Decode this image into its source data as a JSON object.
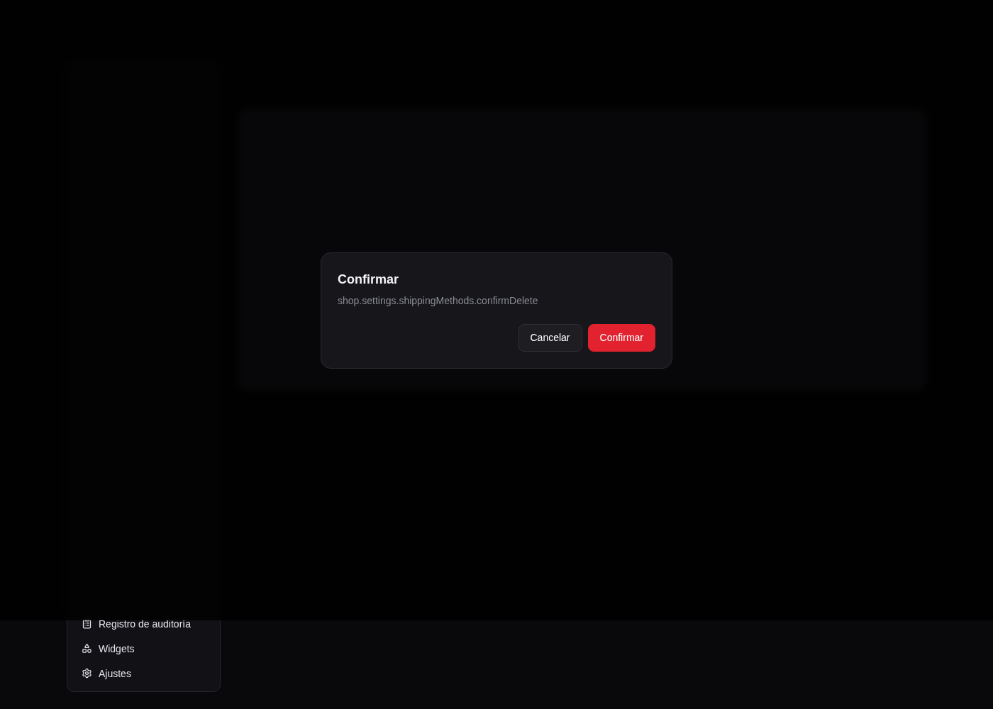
{
  "sidebar": {
    "items": [
      {
        "label": "Registro de auditoría"
      },
      {
        "label": "Widgets"
      },
      {
        "label": "Ajustes"
      }
    ]
  },
  "dialog": {
    "title": "Confirmar",
    "message": "shop.settings.shippingMethods.confirmDelete",
    "buttons": [
      {
        "label": "Cancelar",
        "kind": "secondary"
      },
      {
        "label": "Confirmar",
        "kind": "danger"
      }
    ]
  }
}
